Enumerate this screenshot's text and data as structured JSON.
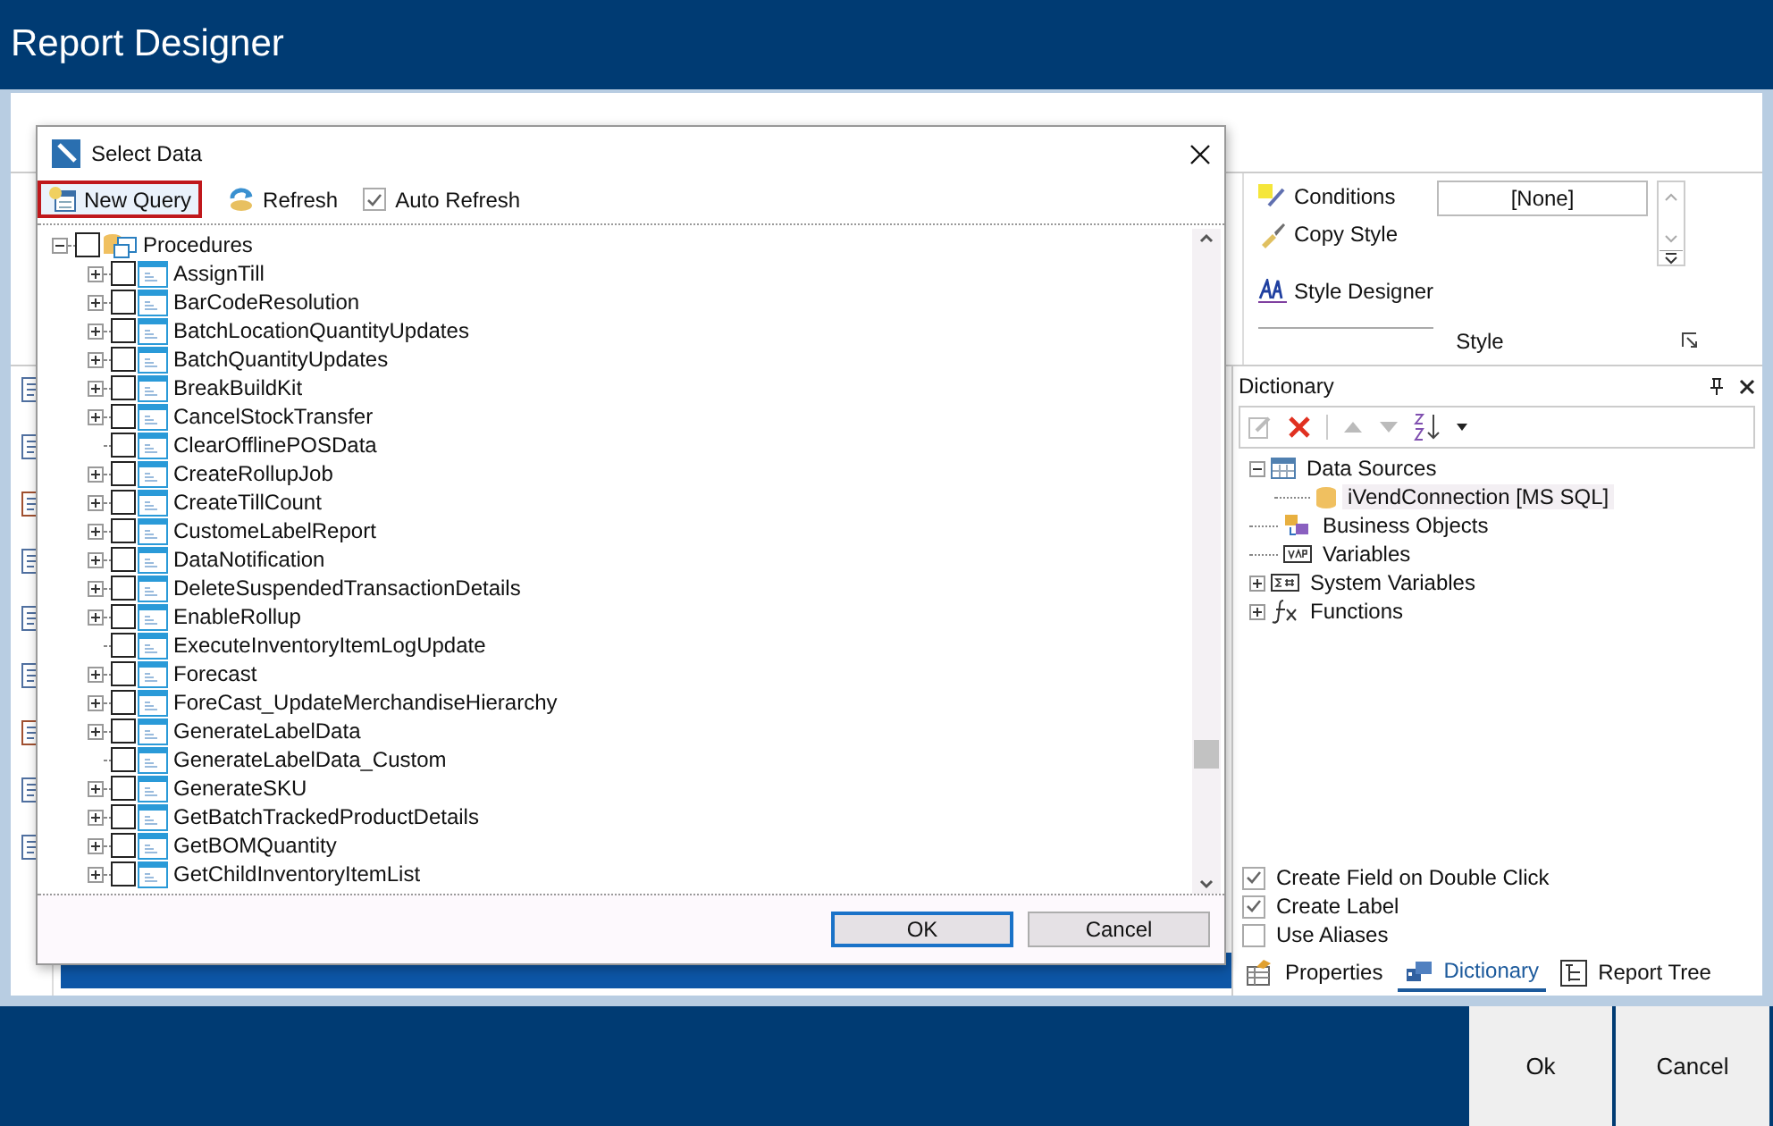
{
  "window": {
    "title": "Report Designer"
  },
  "ribbon": {
    "style_group": {
      "label": "Style",
      "commands": [
        {
          "kind": "conditions",
          "label": "Conditions"
        },
        {
          "kind": "copy",
          "label": "Copy Style"
        },
        {
          "kind": "designer",
          "label": "Style Designer"
        }
      ],
      "style_value": "[None]"
    }
  },
  "dictionary": {
    "title": "Dictionary",
    "tree": [
      {
        "kind": "datasources",
        "label": "Data Sources",
        "expanded": true,
        "children": [
          {
            "label": "iVendConnection [MS SQL]",
            "selected": true
          }
        ]
      },
      {
        "kind": "business",
        "label": "Business Objects"
      },
      {
        "kind": "variables",
        "label": "Variables"
      },
      {
        "kind": "sysvars",
        "label": "System Variables",
        "expanded": false
      },
      {
        "kind": "functions",
        "label": "Functions",
        "expanded": false
      }
    ],
    "options": [
      {
        "label": "Create Field on Double Click",
        "checked": true
      },
      {
        "label": "Create Label",
        "checked": true
      },
      {
        "label": "Use Aliases",
        "checked": false
      }
    ],
    "tabs": [
      {
        "kind": "properties",
        "label": "Properties",
        "selected": false
      },
      {
        "kind": "dictionary",
        "label": "Dictionary",
        "selected": true
      },
      {
        "kind": "tree",
        "label": "Report Tree",
        "selected": false
      }
    ]
  },
  "dialog": {
    "title": "Select Data",
    "toolbar": {
      "new_query": {
        "label": "New Query",
        "highlighted": true
      },
      "refresh": {
        "label": "Refresh"
      },
      "auto_refresh": {
        "label": "Auto Refresh",
        "checked": true
      }
    },
    "tree": {
      "label": "Procedures",
      "expanded": true,
      "checked": false,
      "children": [
        {
          "label": "AssignTill",
          "expandable": true,
          "checked": false
        },
        {
          "label": "BarCodeResolution",
          "expandable": true,
          "checked": false
        },
        {
          "label": "BatchLocationQuantityUpdates",
          "expandable": true,
          "checked": false
        },
        {
          "label": "BatchQuantityUpdates",
          "expandable": true,
          "checked": false
        },
        {
          "label": "BreakBuildKit",
          "expandable": true,
          "checked": false
        },
        {
          "label": "CancelStockTransfer",
          "expandable": true,
          "checked": false
        },
        {
          "label": "ClearOfflinePOSData",
          "expandable": false,
          "checked": false
        },
        {
          "label": "CreateRollupJob",
          "expandable": true,
          "checked": false
        },
        {
          "label": "CreateTillCount",
          "expandable": true,
          "checked": false
        },
        {
          "label": "CustomeLabelReport",
          "expandable": true,
          "checked": false
        },
        {
          "label": "DataNotification",
          "expandable": true,
          "checked": false
        },
        {
          "label": "DeleteSuspendedTransactionDetails",
          "expandable": true,
          "checked": false
        },
        {
          "label": "EnableRollup",
          "expandable": true,
          "checked": false
        },
        {
          "label": "ExecuteInventoryItemLogUpdate",
          "expandable": false,
          "checked": false
        },
        {
          "label": "Forecast",
          "expandable": true,
          "checked": false
        },
        {
          "label": "ForeCast_UpdateMerchandiseHierarchy",
          "expandable": true,
          "checked": false
        },
        {
          "label": "GenerateLabelData",
          "expandable": true,
          "checked": false
        },
        {
          "label": "GenerateLabelData_Custom",
          "expandable": false,
          "checked": false
        },
        {
          "label": "GenerateSKU",
          "expandable": true,
          "checked": false
        },
        {
          "label": "GetBatchTrackedProductDetails",
          "expandable": true,
          "checked": false
        },
        {
          "label": "GetBOMQuantity",
          "expandable": true,
          "checked": false
        },
        {
          "label": "GetChildInventoryItemList",
          "expandable": true,
          "checked": false
        }
      ]
    },
    "buttons": [
      {
        "label": "OK",
        "default": true
      },
      {
        "label": "Cancel",
        "default": false
      }
    ]
  },
  "footer_buttons": [
    "Ok",
    "Cancel"
  ]
}
